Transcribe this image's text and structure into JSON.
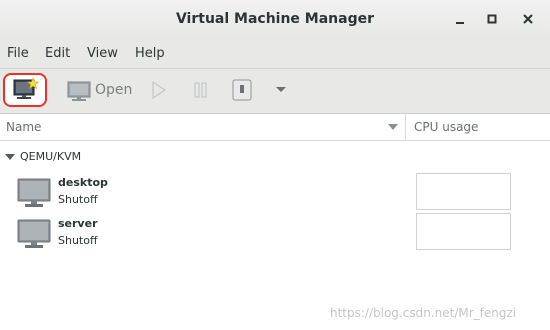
{
  "window": {
    "title": "Virtual Machine Manager",
    "controls": [
      "minimize",
      "maximize",
      "close"
    ]
  },
  "menubar": {
    "items": [
      "File",
      "Edit",
      "View",
      "Help"
    ]
  },
  "toolbar": {
    "new_vm_icon": "new-vm-icon",
    "open_label": "Open",
    "run_icon": "play-icon",
    "pause_icon": "pause-icon",
    "shutdown_icon": "power-icon",
    "dropdown_icon": "chevron-down-icon",
    "highlight_color": "#e8322a"
  },
  "columns": {
    "name": "Name",
    "cpu_usage": "CPU usage"
  },
  "connections": [
    {
      "label": "QEMU/KVM",
      "expanded": true,
      "vms": [
        {
          "name": "desktop",
          "status": "Shutoff"
        },
        {
          "name": "server",
          "status": "Shutoff"
        }
      ]
    }
  ],
  "watermark": "https://blog.csdn.net/Mr_fengzi"
}
